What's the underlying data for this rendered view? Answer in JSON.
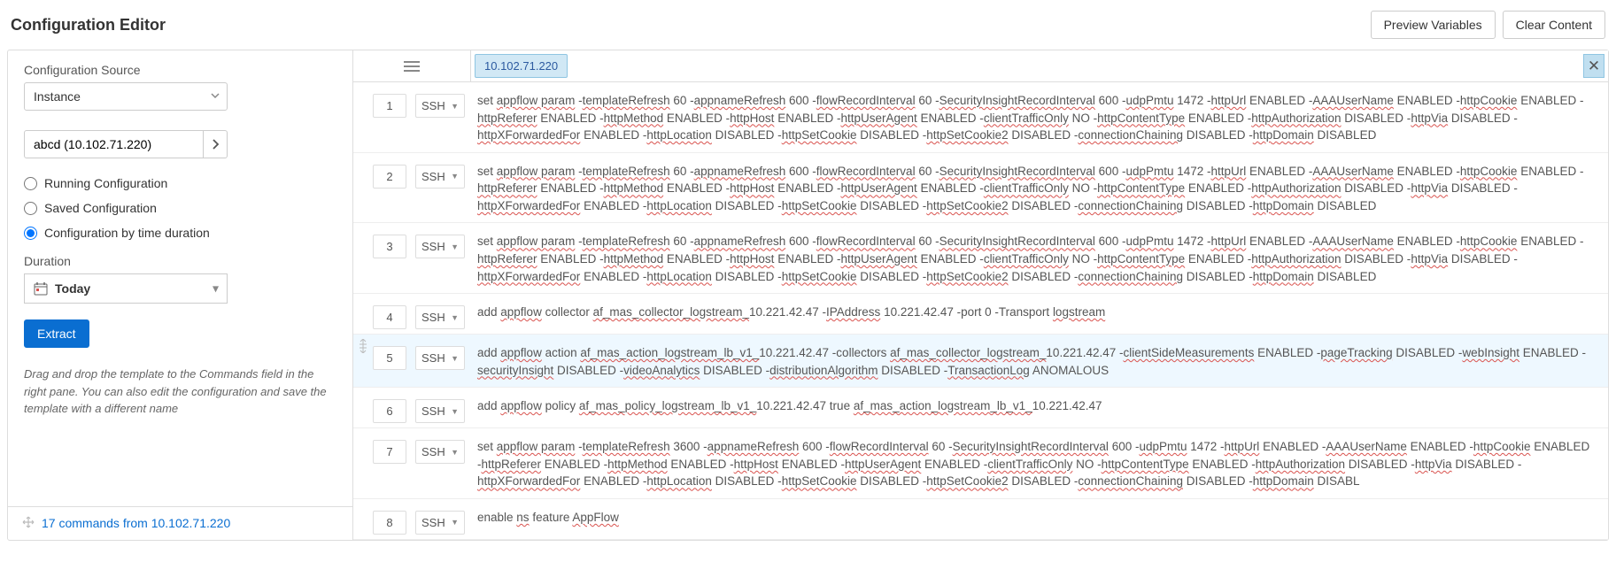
{
  "header": {
    "title": "Configuration Editor",
    "buttons": {
      "preview": "Preview Variables",
      "clear": "Clear Content"
    }
  },
  "left": {
    "source_label": "Configuration Source",
    "source_value": "Instance",
    "instance_value": "abcd (10.102.71.220)",
    "radios": {
      "running": "Running Configuration",
      "saved": "Saved Configuration",
      "bytime": "Configuration by time duration",
      "selected": "bytime"
    },
    "duration_label": "Duration",
    "duration_value": "Today",
    "extract_label": "Extract",
    "help_text": "Drag and drop the template to the Commands field in the right pane. You can also edit the configuration and save the template with a different name",
    "footer_link": "17 commands from 10.102.71.220"
  },
  "right": {
    "tab_label": "10.102.71.220",
    "type_label": "SSH",
    "rows": [
      {
        "n": 1,
        "tokens": [
          "set ",
          [
            "appflow param",
            true
          ],
          " -",
          [
            "templateRefresh",
            true
          ],
          " 60 -",
          [
            "appnameRefresh",
            true
          ],
          " 600 -",
          [
            "flowRecordInterval",
            true
          ],
          " 60 -",
          [
            "SecurityInsightRecordInterval",
            true
          ],
          " 600 -",
          [
            "udpPmtu",
            true
          ],
          " 1472 -",
          [
            "httpUrl",
            true
          ],
          " ENABLED -",
          [
            "AAAUserName",
            true
          ],
          " ENABLED -",
          [
            "httpCookie",
            true
          ],
          " ENABLED -",
          [
            "httpReferer",
            true
          ],
          " ENABLED -",
          [
            "httpMethod",
            true
          ],
          " ENABLED -",
          [
            "httpHost",
            true
          ],
          " ENABLED -",
          [
            "httpUserAgent",
            true
          ],
          " ENABLED -",
          [
            "clientTrafficOnly",
            true
          ],
          " NO -",
          [
            "httpContentType",
            true
          ],
          " ENABLED -",
          [
            "httpAuthorization",
            true
          ],
          " DISABLED -",
          [
            "httpVia",
            true
          ],
          " DISABLED -",
          [
            "httpXForwardedFor",
            true
          ],
          " ENABLED -",
          [
            "httpLocation",
            true
          ],
          " DISABLED -",
          [
            "httpSetCookie",
            true
          ],
          " DISABLED -",
          [
            "httpSetCookie2",
            true
          ],
          " DISABLED -",
          [
            "connectionChaining",
            true
          ],
          " DISABLED -",
          [
            "httpDomain",
            true
          ],
          " DISABLED"
        ]
      },
      {
        "n": 2,
        "tokens": [
          "set ",
          [
            "appflow param",
            true
          ],
          " -",
          [
            "templateRefresh",
            true
          ],
          " 60 -",
          [
            "appnameRefresh",
            true
          ],
          " 600 -",
          [
            "flowRecordInterval",
            true
          ],
          " 60 -",
          [
            "SecurityInsightRecordInterval",
            true
          ],
          " 600 -",
          [
            "udpPmtu",
            true
          ],
          " 1472 -",
          [
            "httpUrl",
            true
          ],
          " ENABLED -",
          [
            "AAAUserName",
            true
          ],
          " ENABLED -",
          [
            "httpCookie",
            true
          ],
          " ENABLED -",
          [
            "httpReferer",
            true
          ],
          " ENABLED -",
          [
            "httpMethod",
            true
          ],
          " ENABLED -",
          [
            "httpHost",
            true
          ],
          " ENABLED -",
          [
            "httpUserAgent",
            true
          ],
          " ENABLED -",
          [
            "clientTrafficOnly",
            true
          ],
          " NO -",
          [
            "httpContentType",
            true
          ],
          " ENABLED -",
          [
            "httpAuthorization",
            true
          ],
          " DISABLED -",
          [
            "httpVia",
            true
          ],
          " DISABLED -",
          [
            "httpXForwardedFor",
            true
          ],
          " ENABLED -",
          [
            "httpLocation",
            true
          ],
          " DISABLED -",
          [
            "httpSetCookie",
            true
          ],
          " DISABLED -",
          [
            "httpSetCookie2",
            true
          ],
          " DISABLED -",
          [
            "connectionChaining",
            true
          ],
          " DISABLED -",
          [
            "httpDomain",
            true
          ],
          " DISABLED"
        ]
      },
      {
        "n": 3,
        "tokens": [
          "set ",
          [
            "appflow param",
            true
          ],
          " -",
          [
            "templateRefresh",
            true
          ],
          " 60 -",
          [
            "appnameRefresh",
            true
          ],
          " 600 -",
          [
            "flowRecordInterval",
            true
          ],
          " 60 -",
          [
            "SecurityInsightRecordInterval",
            true
          ],
          " 600 -",
          [
            "udpPmtu",
            true
          ],
          " 1472 -",
          [
            "httpUrl",
            true
          ],
          " ENABLED -",
          [
            "AAAUserName",
            true
          ],
          " ENABLED -",
          [
            "httpCookie",
            true
          ],
          " ENABLED -",
          [
            "httpReferer",
            true
          ],
          " ENABLED -",
          [
            "httpMethod",
            true
          ],
          " ENABLED -",
          [
            "httpHost",
            true
          ],
          " ENABLED -",
          [
            "httpUserAgent",
            true
          ],
          " ENABLED -",
          [
            "clientTrafficOnly",
            true
          ],
          " NO -",
          [
            "httpContentType",
            true
          ],
          " ENABLED -",
          [
            "httpAuthorization",
            true
          ],
          " DISABLED -",
          [
            "httpVia",
            true
          ],
          " DISABLED -",
          [
            "httpXForwardedFor",
            true
          ],
          " ENABLED -",
          [
            "httpLocation",
            true
          ],
          " DISABLED -",
          [
            "httpSetCookie",
            true
          ],
          " DISABLED -",
          [
            "httpSetCookie2",
            true
          ],
          " DISABLED -",
          [
            "connectionChaining",
            true
          ],
          " DISABLED -",
          [
            "httpDomain",
            true
          ],
          " DISABLED"
        ]
      },
      {
        "n": 4,
        "tokens": [
          "add ",
          [
            "appflow",
            true
          ],
          " collector ",
          [
            "af_mas_collector_logstream_",
            true
          ],
          "10.221.42.47 -",
          [
            "IPAddress",
            true
          ],
          " 10.221.42.47 -port 0 -Transport ",
          [
            "logstream",
            true
          ]
        ]
      },
      {
        "n": 5,
        "active": true,
        "tokens": [
          "add ",
          [
            "appflow",
            true
          ],
          " action ",
          [
            "af_mas_action_logstream_lb_v1_",
            true
          ],
          "10.221.42.47 -collectors ",
          [
            "af_mas_collector_logstream_",
            true
          ],
          "10.221.42.47 -",
          [
            "clientSideMeasurements",
            true
          ],
          " ENABLED -",
          [
            "pageTracking",
            true
          ],
          " DISABLED -",
          [
            "webInsight",
            true
          ],
          " ENABLED -",
          [
            "securityInsight",
            true
          ],
          " DISABLED -",
          [
            "videoAnalytics",
            true
          ],
          " DISABLED -",
          [
            "distributionAlgorithm",
            true
          ],
          " DISABLED -",
          [
            "TransactionLog",
            true
          ],
          " ANOMALOUS"
        ]
      },
      {
        "n": 6,
        "tokens": [
          "add ",
          [
            "appflow",
            true
          ],
          " policy ",
          [
            "af_mas_policy_logstream_lb_v1_",
            true
          ],
          "10.221.42.47 true ",
          [
            "af_mas_action_logstream_lb_v1_",
            true
          ],
          "10.221.42.47"
        ]
      },
      {
        "n": 7,
        "tokens": [
          "set ",
          [
            "appflow param",
            true
          ],
          " -",
          [
            "templateRefresh",
            true
          ],
          " 3600 -",
          [
            "appnameRefresh",
            true
          ],
          " 600 -",
          [
            "flowRecordInterval",
            true
          ],
          " 60 -",
          [
            "SecurityInsightRecordInterval",
            true
          ],
          " 600 -",
          [
            "udpPmtu",
            true
          ],
          " 1472 -",
          [
            "httpUrl",
            true
          ],
          " ENABLED -",
          [
            "AAAUserName",
            true
          ],
          " ENABLED -",
          [
            "httpCookie",
            true
          ],
          " ENABLED -",
          [
            "httpReferer",
            true
          ],
          " ENABLED -",
          [
            "httpMethod",
            true
          ],
          " ENABLED -",
          [
            "httpHost",
            true
          ],
          " ENABLED -",
          [
            "httpUserAgent",
            true
          ],
          " ENABLED -",
          [
            "clientTrafficOnly",
            true
          ],
          " NO -",
          [
            "httpContentType",
            true
          ],
          " ENABLED -",
          [
            "httpAuthorization",
            true
          ],
          " DISABLED -",
          [
            "httpVia",
            true
          ],
          " DISABLED -",
          [
            "httpXForwardedFor",
            true
          ],
          " ENABLED -",
          [
            "httpLocation",
            true
          ],
          " DISABLED -",
          [
            "httpSetCookie",
            true
          ],
          " DISABLED -",
          [
            "httpSetCookie2",
            true
          ],
          " DISABLED -",
          [
            "connectionChaining",
            true
          ],
          " DISABLED -",
          [
            "httpDomain",
            true
          ],
          " DISABL"
        ]
      },
      {
        "n": 8,
        "tokens": [
          "enable ",
          [
            "ns",
            true
          ],
          " feature ",
          [
            "AppFlow",
            true
          ]
        ]
      }
    ]
  }
}
